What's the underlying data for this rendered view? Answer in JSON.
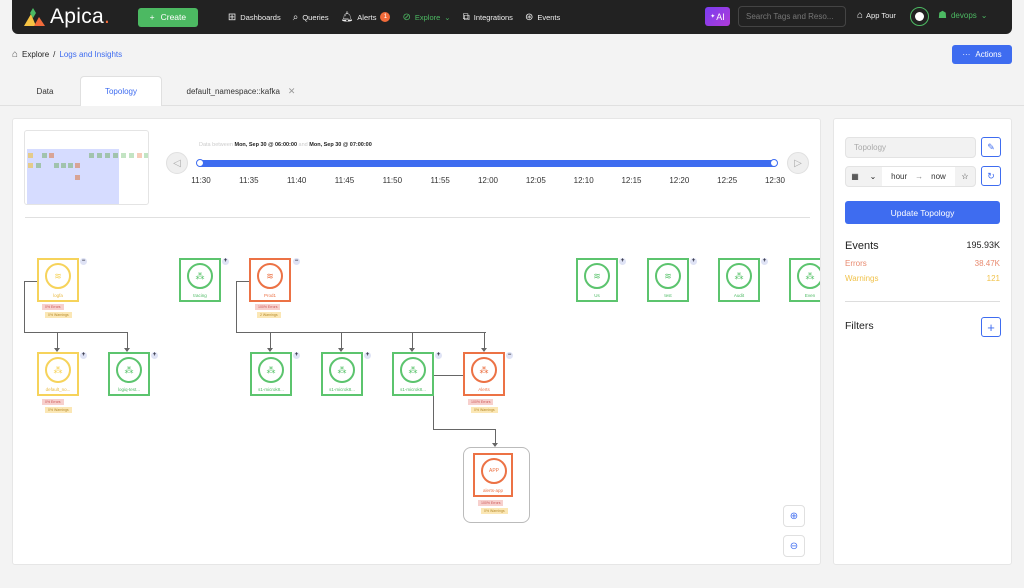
{
  "topbar": {
    "brand": "Apica",
    "create_label": "Create",
    "nav": [
      {
        "label": "Dashboards",
        "icon": "grid-icon"
      },
      {
        "label": "Queries",
        "icon": "search-icon"
      },
      {
        "label": "Alerts",
        "icon": "bell-icon",
        "badge": "1"
      },
      {
        "label": "Explore",
        "icon": "compass-icon",
        "active": true
      },
      {
        "label": "Integrations",
        "icon": "integrations-icon"
      },
      {
        "label": "Events",
        "icon": "events-icon"
      }
    ],
    "ai_label": "AI",
    "search_placeholder": "Search Tags and Reso...",
    "app_tour_label": "App Tour",
    "user_label": "devops"
  },
  "breadcrumb": {
    "root": "Explore",
    "separator": "/",
    "current": "Logs and Insights"
  },
  "actions_label": "Actions",
  "tabs": [
    {
      "label": "Data"
    },
    {
      "label": "Topology",
      "active": true
    },
    {
      "label": "default_namespace::kafka",
      "closable": true
    }
  ],
  "timeline": {
    "prefix": "Data between",
    "start": "Mon, Sep 30 @ 06:00:00",
    "joiner": "and",
    "end": "Mon, Sep 30 @ 07:00:00",
    "ticks": [
      "11:30",
      "11:35",
      "11:40",
      "11:45",
      "11:50",
      "11:55",
      "12:00",
      "12:05",
      "12:10",
      "12:15",
      "12:20",
      "12:25",
      "12:30"
    ]
  },
  "nodes": {
    "logfa": {
      "label": "logfa",
      "err": "0% Errors",
      "warn": "0% Warnings"
    },
    "tracing": {
      "label": "tracing"
    },
    "prod1": {
      "label": "Prod1",
      "err": "100% Errors",
      "warn": "2 Warnings"
    },
    "us": {
      "label": "Us"
    },
    "test": {
      "label": "test"
    },
    "audit": {
      "label": "Audit"
    },
    "events": {
      "label": "Even"
    },
    "default_ns": {
      "label": "default_no...",
      "err": "0% Errors",
      "warn": "0% Warnings"
    },
    "logiq_test": {
      "label": "logiq-test..."
    },
    "s1a": {
      "label": "s1-microk8..."
    },
    "s1b": {
      "label": "s1-microk8..."
    },
    "s1c": {
      "label": "s1-microk8..."
    },
    "alerts": {
      "label": "Alerts",
      "err": "100% Errors",
      "warn": "0% Warnings"
    },
    "alerts_app": {
      "label": "alerts-app",
      "err": "100% Errors",
      "warn": "0% Warnings"
    }
  },
  "side": {
    "topology_placeholder": "Topology",
    "range_from": "hour",
    "range_to": "now",
    "update_label": "Update Topology",
    "events_label": "Events",
    "events_value": "195.93K",
    "errors_label": "Errors",
    "errors_value": "38.47K",
    "warnings_label": "Warnings",
    "warnings_value": "121",
    "filters_label": "Filters"
  }
}
